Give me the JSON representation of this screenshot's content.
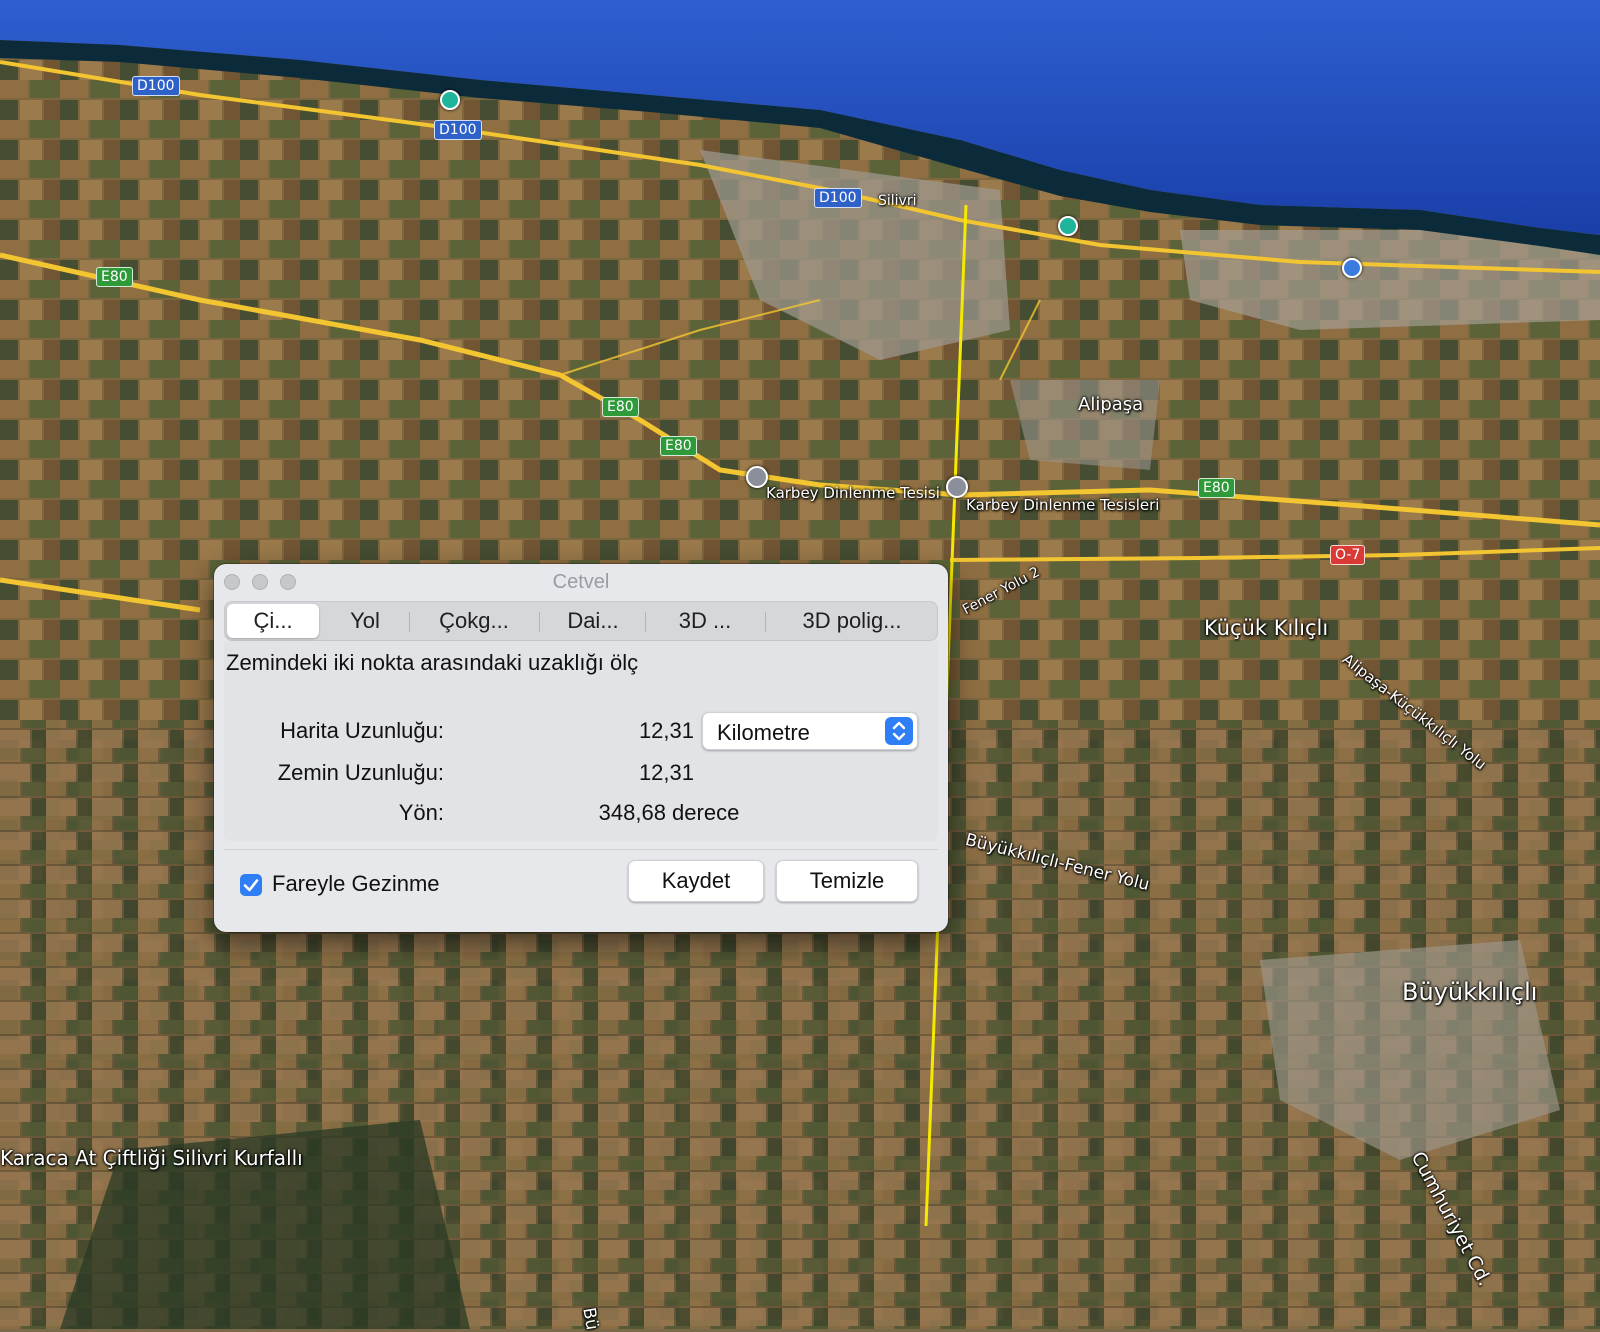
{
  "map": {
    "places": {
      "silivri": "Silivri",
      "alipasa": "Alipaşa",
      "kucuk_kilicli": "Küçük Kılıçlı",
      "buyukkilicli": "Büyükkılıçlı",
      "karbey1": "Karbey Dinlenme Tesisi",
      "karbey2": "Karbey Dinlenme Tesisleri",
      "karaca": "Karaca At Çiftliği Silivri Kurfallı",
      "fener_yolu": "Fener Yolu 2",
      "alipasa_road": "Alipaşa-Küçükkılıçlı Yolu",
      "buyukkilicli_road": "Büyükkılıçlı-Fener Yolu",
      "cumhuriyet": "Cumhuriyet Cd.",
      "bu": "Bü"
    },
    "shields": {
      "d100": "D100",
      "e80": "E80",
      "o7": "O-7"
    },
    "colors": {
      "sea_deep": "#0f2f8a",
      "sea_light": "#2e5fd0",
      "coast": "#0b2a3a",
      "road": "#f2c531",
      "ruler_line": "#f5e900"
    }
  },
  "dialog": {
    "title": "Cetvel",
    "tabs": [
      "Çi...",
      "Yol",
      "Çokg...",
      "Dai...",
      "3D ...",
      "3D polig..."
    ],
    "description": "Zemindeki iki nokta arasındaki uzaklığı ölç",
    "map_length_label": "Harita Uzunluğu:",
    "map_length_value": "12,31",
    "ground_length_label": "Zemin Uzunluğu:",
    "ground_length_value": "12,31",
    "heading_label": "Yön:",
    "heading_value": "348,68 derece",
    "unit_select": "Kilometre",
    "mouse_nav_label": "Fareyle Gezinme",
    "mouse_nav_checked": true,
    "save_label": "Kaydet",
    "clear_label": "Temizle"
  }
}
